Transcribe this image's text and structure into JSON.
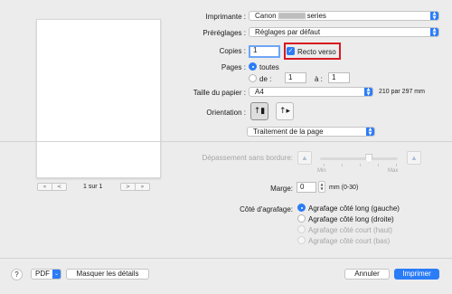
{
  "preview": {
    "page_label": "1 sur 1",
    "first_arrow": "«",
    "prev_arrow": "<",
    "next_arrow": ">",
    "last_arrow": "»"
  },
  "printer": {
    "label": "Imprimante :",
    "value_prefix": "Canon",
    "value_suffix": "series"
  },
  "presets": {
    "label": "Préréglages :",
    "value": "Réglages par défaut"
  },
  "copies": {
    "label": "Copies :",
    "value": "1",
    "duplex_label": "Recto verso",
    "duplex_checked": true
  },
  "pages": {
    "label": "Pages :",
    "all_label": "toutes",
    "from_label": "de :",
    "from_value": "1",
    "to_label": "à :",
    "to_value": "1"
  },
  "paper": {
    "label": "Taille du papier :",
    "value": "A4",
    "dims": "210 par 297 mm"
  },
  "orientation": {
    "label": "Orientation :"
  },
  "section": {
    "value": "Traitement de la page"
  },
  "borderless": {
    "label": "Dépassement sans bordure:",
    "min": "Min",
    "max": "Max",
    "level_percent": 63
  },
  "margin": {
    "label": "Marge:",
    "value": "0",
    "unit": "mm (0-30)"
  },
  "stapling": {
    "label": "Côté d'agrafage:",
    "options": [
      {
        "label": "Agrafage côté long (gauche)",
        "selected": true,
        "enabled": true
      },
      {
        "label": "Agrafage côté long (droite)",
        "selected": false,
        "enabled": true
      },
      {
        "label": "Agrafage côté court (haut)",
        "selected": false,
        "enabled": false
      },
      {
        "label": "Agrafage côté court (bas)",
        "selected": false,
        "enabled": false
      }
    ]
  },
  "footer": {
    "help": "?",
    "pdf": "PDF",
    "hide_details": "Masquer les détails",
    "cancel": "Annuler",
    "print": "Imprimer"
  },
  "colors": {
    "accent": "#2b7cf7",
    "highlight": "#d71920"
  }
}
